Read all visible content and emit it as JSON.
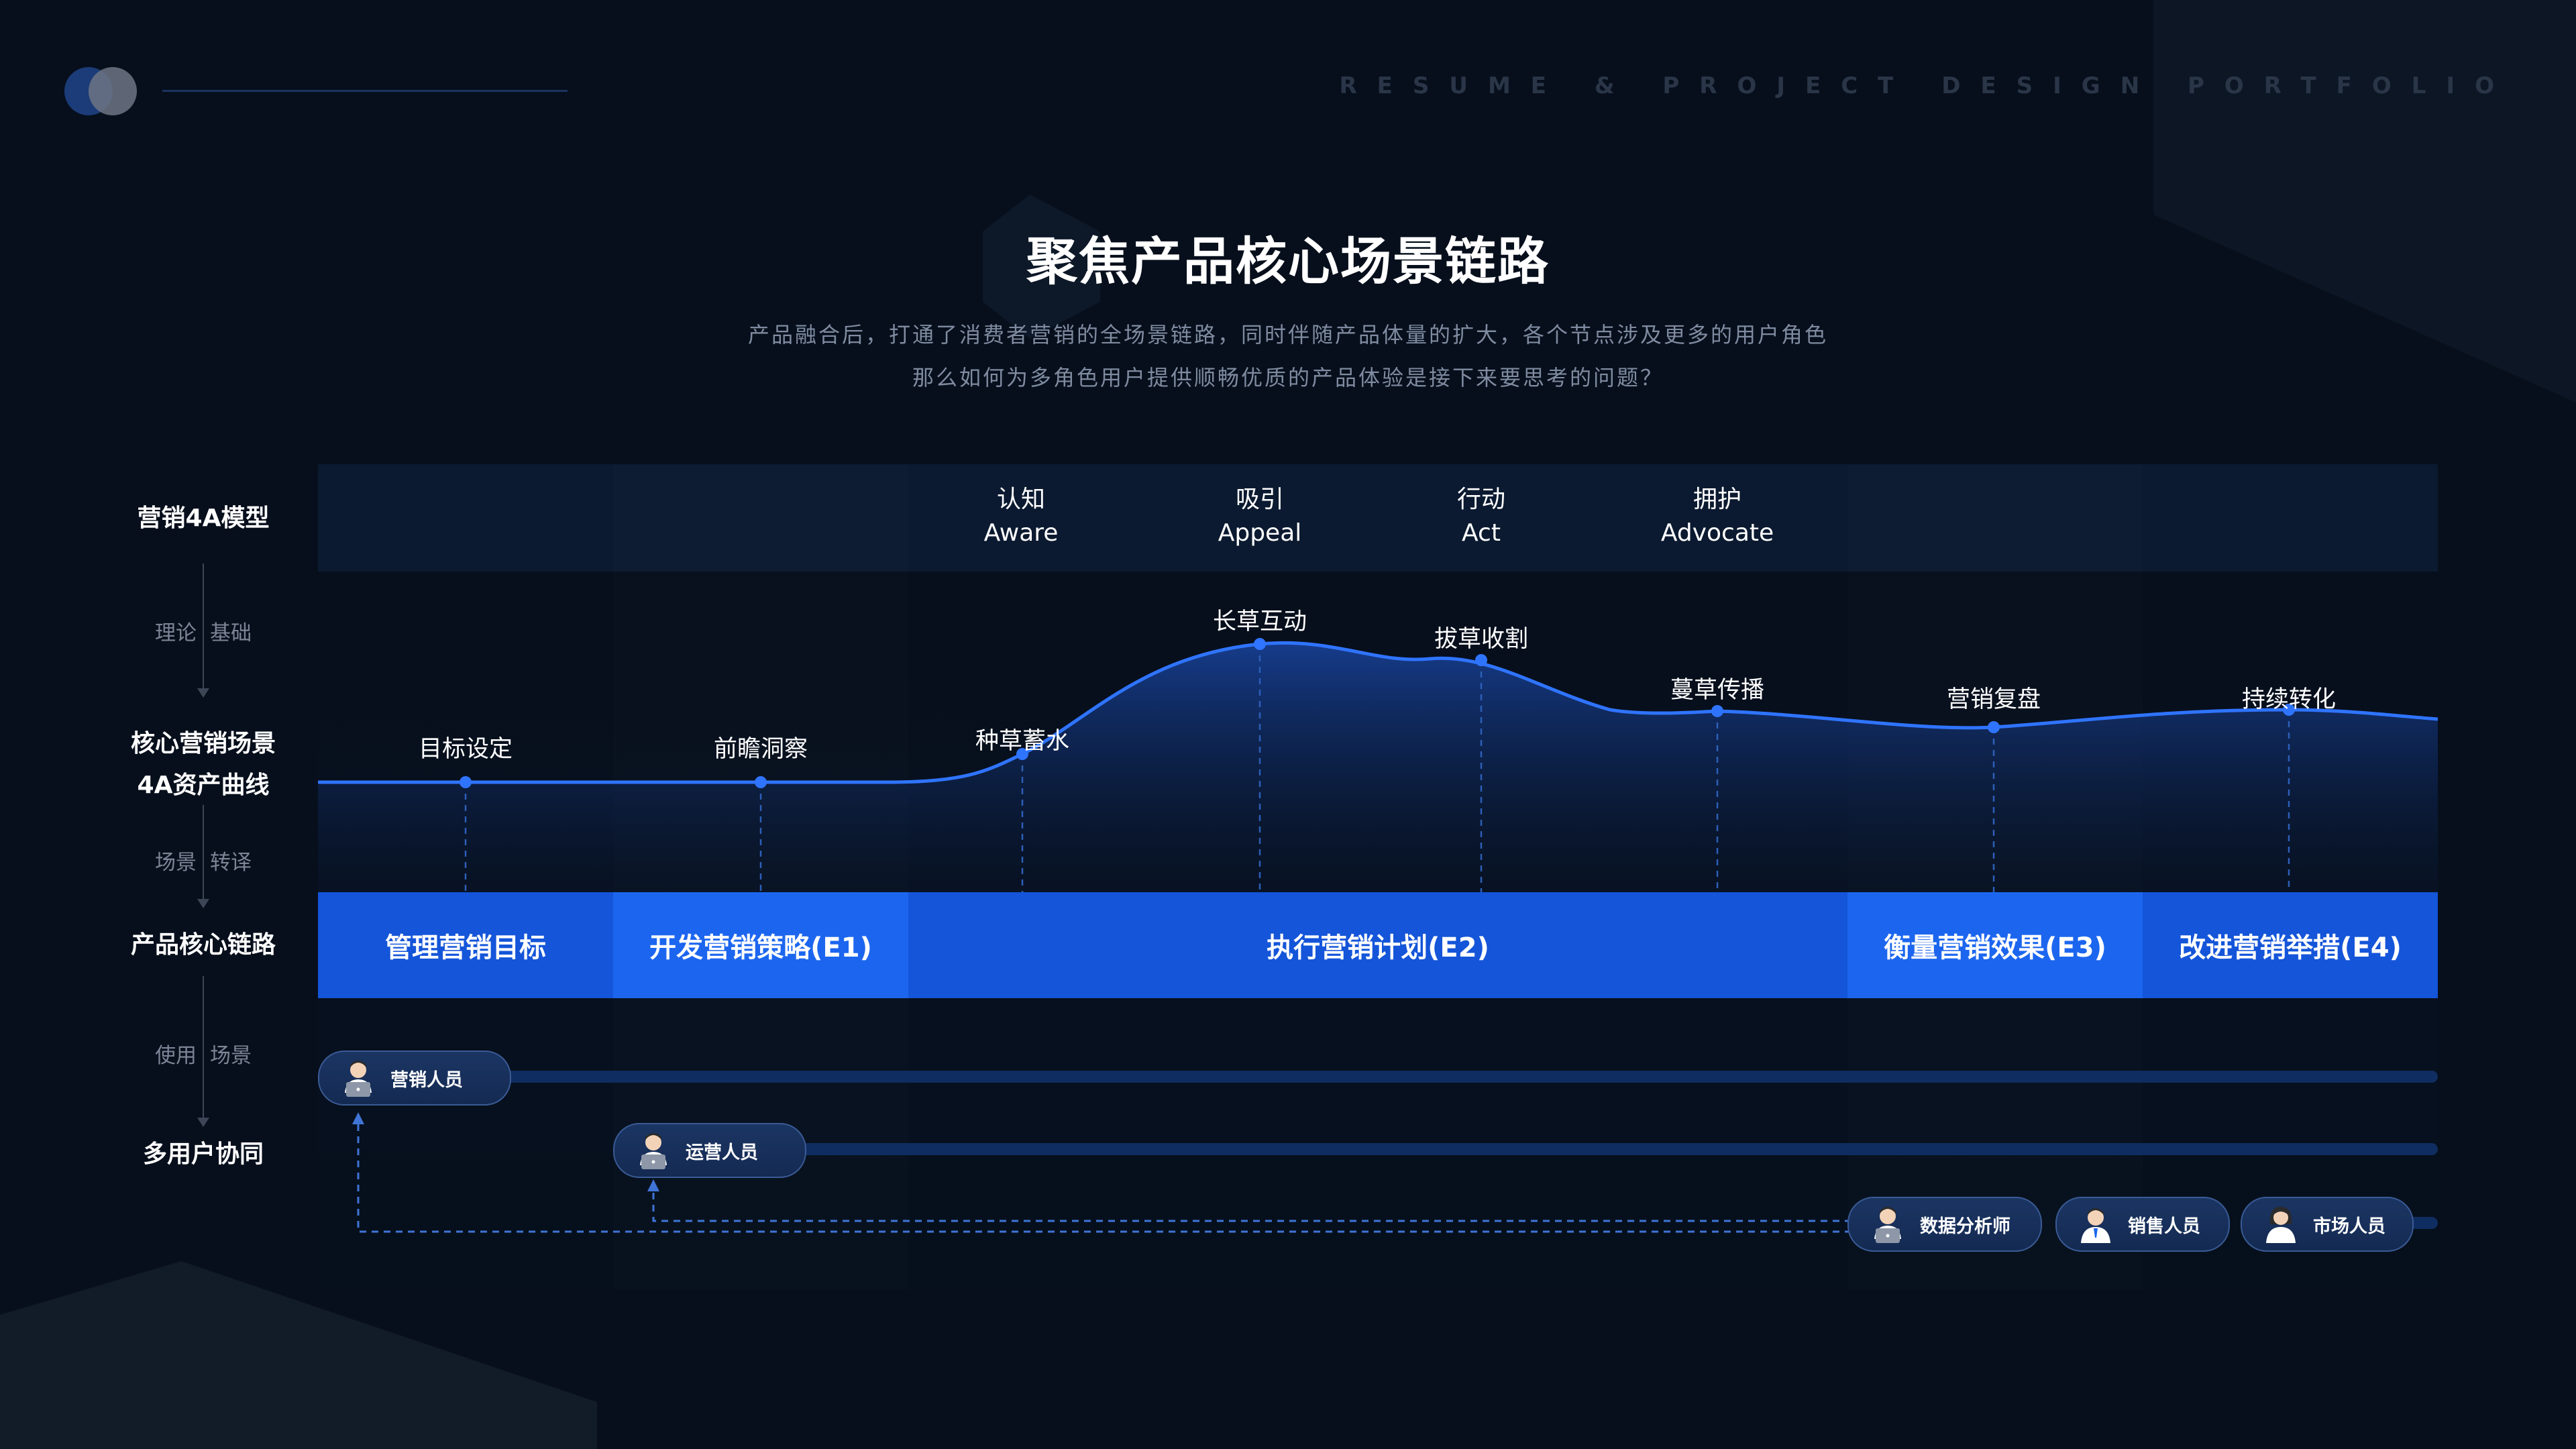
{
  "header": {
    "portfolio_label": "RESUME & PROJECT DESIGN PORTFOLIO"
  },
  "title": "聚焦产品核心场景链路",
  "subtitle": {
    "line1": "产品融合后，打通了消费者营销的全场景链路，同时伴随产品体量的扩大，各个节点涉及更多的用户角色",
    "line2": "那么如何为多角色用户提供顺畅优质的产品体验是接下来要思考的问题？"
  },
  "row_labels": {
    "model": "营销4A模型",
    "scene_line1": "核心营销场景",
    "scene_line2": "4A资产曲线",
    "chain": "产品核心链路",
    "users": "多用户协同"
  },
  "step_labels": {
    "theory": [
      "理论",
      "基础"
    ],
    "scene": [
      "场景",
      "转译"
    ],
    "usage": [
      "使用",
      "场景"
    ]
  },
  "stages": [
    {
      "cn": "认知",
      "en": "Aware"
    },
    {
      "cn": "吸引",
      "en": "Appeal"
    },
    {
      "cn": "行动",
      "en": "Act"
    },
    {
      "cn": "拥护",
      "en": "Advocate"
    }
  ],
  "curve_nodes": [
    {
      "label": "目标设定"
    },
    {
      "label": "前瞻洞察"
    },
    {
      "label": "种草蓄水"
    },
    {
      "label": "长草互动"
    },
    {
      "label": "拔草收割"
    },
    {
      "label": "蔓草传播"
    },
    {
      "label": "营销复盘"
    },
    {
      "label": "持续转化"
    }
  ],
  "chain": [
    {
      "label": "管理营销目标",
      "color": "#1455d9"
    },
    {
      "label": "开发营销策略(E1)",
      "color": "#1c66ef"
    },
    {
      "label": "执行营销计划(E2)",
      "color": "#1455d9"
    },
    {
      "label": "衡量营销效果(E3)",
      "color": "#1c66ef"
    },
    {
      "label": "改进营销举措(E4)",
      "color": "#1455d9"
    }
  ],
  "roles": [
    {
      "label": "营销人员",
      "icon": "person-laptop-icon"
    },
    {
      "label": "运营人员",
      "icon": "person-laptop-icon"
    },
    {
      "label": "数据分析师",
      "icon": "person-laptop-icon"
    },
    {
      "label": "销售人员",
      "icon": "person-icon"
    },
    {
      "label": "市场人员",
      "icon": "person-female-icon"
    }
  ],
  "colors": {
    "background": "#070f1c",
    "accent": "#1c66ef",
    "curve": "#2f74ff",
    "track": "#0f2d60",
    "muted_text": "#7f8ba0"
  }
}
